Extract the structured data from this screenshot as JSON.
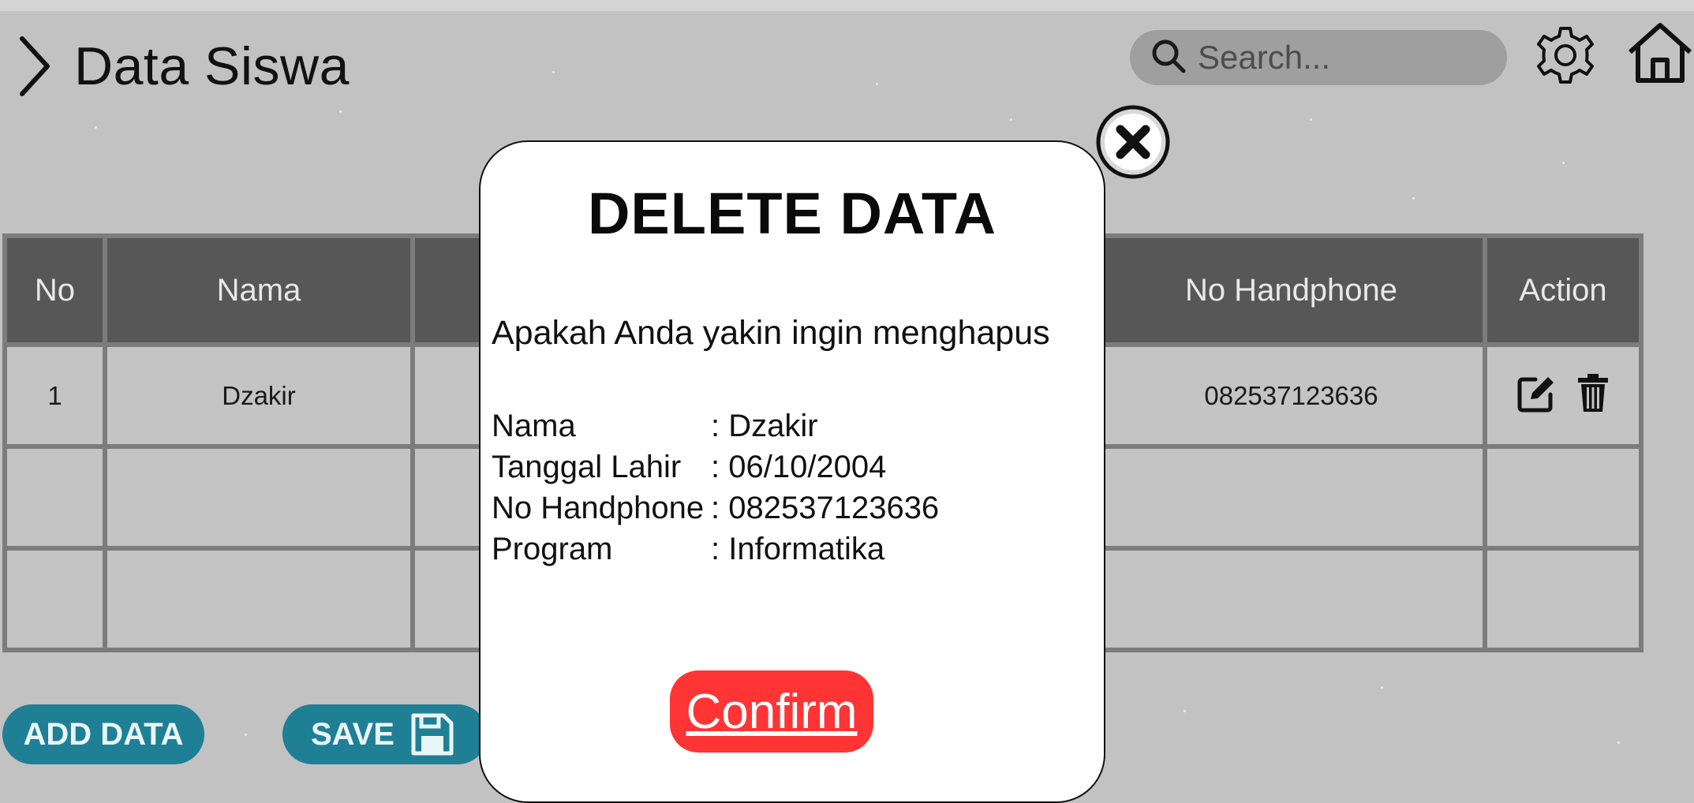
{
  "header": {
    "title": "Data Siswa",
    "search_placeholder": "Search..."
  },
  "table": {
    "columns": [
      "No",
      "Nama",
      "",
      "No Handphone",
      "Action"
    ],
    "rows": [
      {
        "no": "1",
        "nama": "Dzakir",
        "hp": "082537123636"
      }
    ]
  },
  "buttons": {
    "add_label": "ADD DATA",
    "save_label": "SAVE"
  },
  "modal": {
    "title": "DELETE DATA",
    "question": "Apakah Anda yakin ingin menghapus",
    "fields": [
      {
        "label": "Nama",
        "value": ": Dzakir"
      },
      {
        "label": "Tanggal Lahir",
        "value": ": 06/10/2004"
      },
      {
        "label": "No Handphone",
        "value": ": 082537123636"
      },
      {
        "label": "Program",
        "value": ": Informatika"
      }
    ],
    "confirm_label": "Confirm"
  },
  "colors": {
    "background": "#c2c2c2",
    "table_header": "#575757",
    "button_teal": "#1f7f95",
    "confirm_red": "#ff3434"
  },
  "icons": [
    "chevron-right-icon",
    "search-icon",
    "gear-icon",
    "home-icon",
    "edit-icon",
    "trash-icon",
    "save-icon",
    "close-icon"
  ]
}
